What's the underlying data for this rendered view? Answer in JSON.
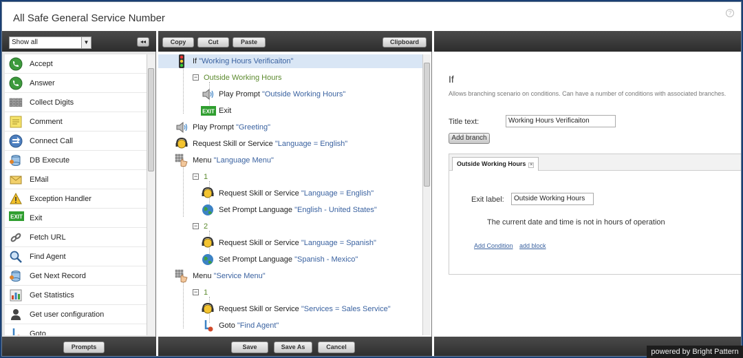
{
  "window": {
    "title": "All Safe General Service Number",
    "help": "?"
  },
  "left_panel": {
    "filter": {
      "value": "Show all"
    },
    "collapse_glyph": "◂◂",
    "items": [
      {
        "label": "Accept",
        "icon": "phone-green-icon"
      },
      {
        "label": "Answer",
        "icon": "phone-green-icon"
      },
      {
        "label": "Collect Digits",
        "icon": "keypad-icon"
      },
      {
        "label": "Comment",
        "icon": "note-icon"
      },
      {
        "label": "Connect Call",
        "icon": "connect-call-icon"
      },
      {
        "label": "DB Execute",
        "icon": "database-icon"
      },
      {
        "label": "EMail",
        "icon": "envelope-icon"
      },
      {
        "label": "Exception Handler",
        "icon": "warning-icon"
      },
      {
        "label": "Exit",
        "icon": "exit-icon"
      },
      {
        "label": "Fetch URL",
        "icon": "link-icon"
      },
      {
        "label": "Find Agent",
        "icon": "magnifier-icon"
      },
      {
        "label": "Get Next Record",
        "icon": "database-icon"
      },
      {
        "label": "Get Statistics",
        "icon": "statistics-icon"
      },
      {
        "label": "Get user configuration",
        "icon": "user-icon"
      },
      {
        "label": "Goto",
        "icon": "goto-icon"
      }
    ],
    "prompts_label": "Prompts"
  },
  "toolbar": {
    "copy": "Copy",
    "cut": "Cut",
    "paste": "Paste",
    "clipboard": "Clipboard"
  },
  "footer": {
    "save": "Save",
    "save_as": "Save As",
    "cancel": "Cancel"
  },
  "tree": [
    {
      "prefix": "If ",
      "quoted": "\"Working Hours Verificaiton\"",
      "icon": "traffic-light-icon"
    },
    {
      "label": "Outside Working Hours"
    },
    {
      "prefix": "Play Prompt ",
      "quoted": "\"Outside Working Hours\"",
      "icon": "speaker-icon"
    },
    {
      "prefix": "Exit",
      "icon": "exit-icon",
      "exit_glyph": "EXIT"
    },
    {
      "prefix": "Play Prompt ",
      "quoted": "\"Greeting\"",
      "icon": "speaker-icon"
    },
    {
      "prefix": "Request Skill or Service ",
      "quoted": "\"Language = English\"",
      "icon": "headset-icon"
    },
    {
      "prefix": "Menu ",
      "quoted": "\"Language Menu\"",
      "icon": "menu-hand-icon"
    },
    {
      "label": "1"
    },
    {
      "prefix": "Request Skill or Service ",
      "quoted": "\"Language = English\"",
      "icon": "headset-icon"
    },
    {
      "prefix": "Set Prompt Language ",
      "quoted": "\"English - United States\"",
      "icon": "globe-icon"
    },
    {
      "label": "2"
    },
    {
      "prefix": "Request Skill or Service ",
      "quoted": "\"Language = Spanish\"",
      "icon": "headset-icon"
    },
    {
      "prefix": "Set Prompt Language ",
      "quoted": "\"Spanish - Mexico\"",
      "icon": "globe-icon"
    },
    {
      "prefix": "Menu ",
      "quoted": "\"Service Menu\"",
      "icon": "menu-hand-icon"
    },
    {
      "label": "1"
    },
    {
      "prefix": "Request Skill or Service ",
      "quoted": "\"Services = Sales Service\"",
      "icon": "headset-icon"
    },
    {
      "prefix": "Goto ",
      "quoted": "\"Find Agent\"",
      "icon": "goto-icon"
    }
  ],
  "properties": {
    "heading": "If",
    "description": "Allows branching scenario on conditions. Can have a number of conditions with associated branches.",
    "title_label": "Title text:",
    "title_value": "Working Hours Verificaiton",
    "add_branch": "Add branch",
    "tab_label": "Outside Working Hours",
    "tab_close": "×",
    "exit_label": "Exit label:",
    "exit_value": "Outside Working Hours",
    "condition_text": "The current date and time is not in hours of operation",
    "add_condition": "Add Condition",
    "add_block": "add block"
  },
  "powered_by": "powered by Bright Pattern",
  "colors": {
    "selected_row": "#d9e6f5",
    "quoted_text": "#3a62a0",
    "branch_text": "#5c8a2e",
    "darkbar": "#3a3a3a"
  }
}
